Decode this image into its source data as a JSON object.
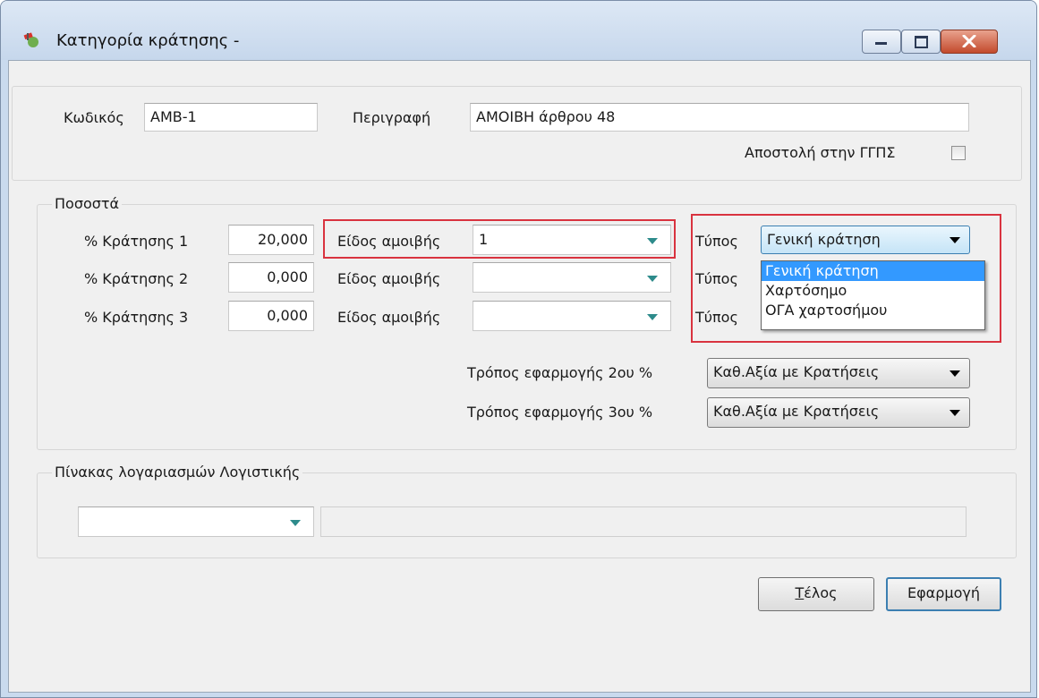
{
  "window": {
    "title": "Κατηγορία κράτησης -",
    "accent": "#d9333f"
  },
  "top": {
    "code_label": "Κωδικός",
    "code_value": "AMB-1",
    "desc_label": "Περιγραφή",
    "desc_value": "ΑΜΟΙΒΗ άρθρου 48",
    "send_label": "Αποστολή στην ΓΓΠΣ",
    "send_checked": false
  },
  "pososta": {
    "legend": "Ποσοστά",
    "rows": [
      {
        "rate_label": "% Κράτησης 1",
        "rate_value": "20,000",
        "fee_label": "Είδος αμοιβής",
        "fee_value": "1",
        "type_label": "Τύπος"
      },
      {
        "rate_label": "% Κράτησης 2",
        "rate_value": "0,000",
        "fee_label": "Είδος αμοιβής",
        "fee_value": "",
        "type_label": "Τύπος"
      },
      {
        "rate_label": "% Κράτησης 3",
        "rate_value": "0,000",
        "fee_label": "Είδος αμοιβής",
        "fee_value": "",
        "type_label": "Τύπος"
      }
    ],
    "type_selected": "Γενική κράτηση",
    "type_options": [
      "Γενική κράτηση",
      "Χαρτόσημο",
      "ΟΓΑ χαρτοσήμου"
    ],
    "method2_label": "Τρόπος εφαρμογής 2ου %",
    "method2_value": "Καθ.Αξία με Κρατήσεις",
    "method3_label": "Τρόπος εφαρμογής 3ου %",
    "method3_value": "Καθ.Αξία με Κρατήσεις"
  },
  "accounts": {
    "legend": "Πίνακας λογαριασμών Λογιστικής",
    "account_value": "",
    "account_desc": ""
  },
  "buttons": {
    "end_first": "Τ",
    "end_rest": "έλος",
    "apply": "Εφαρμογή"
  }
}
